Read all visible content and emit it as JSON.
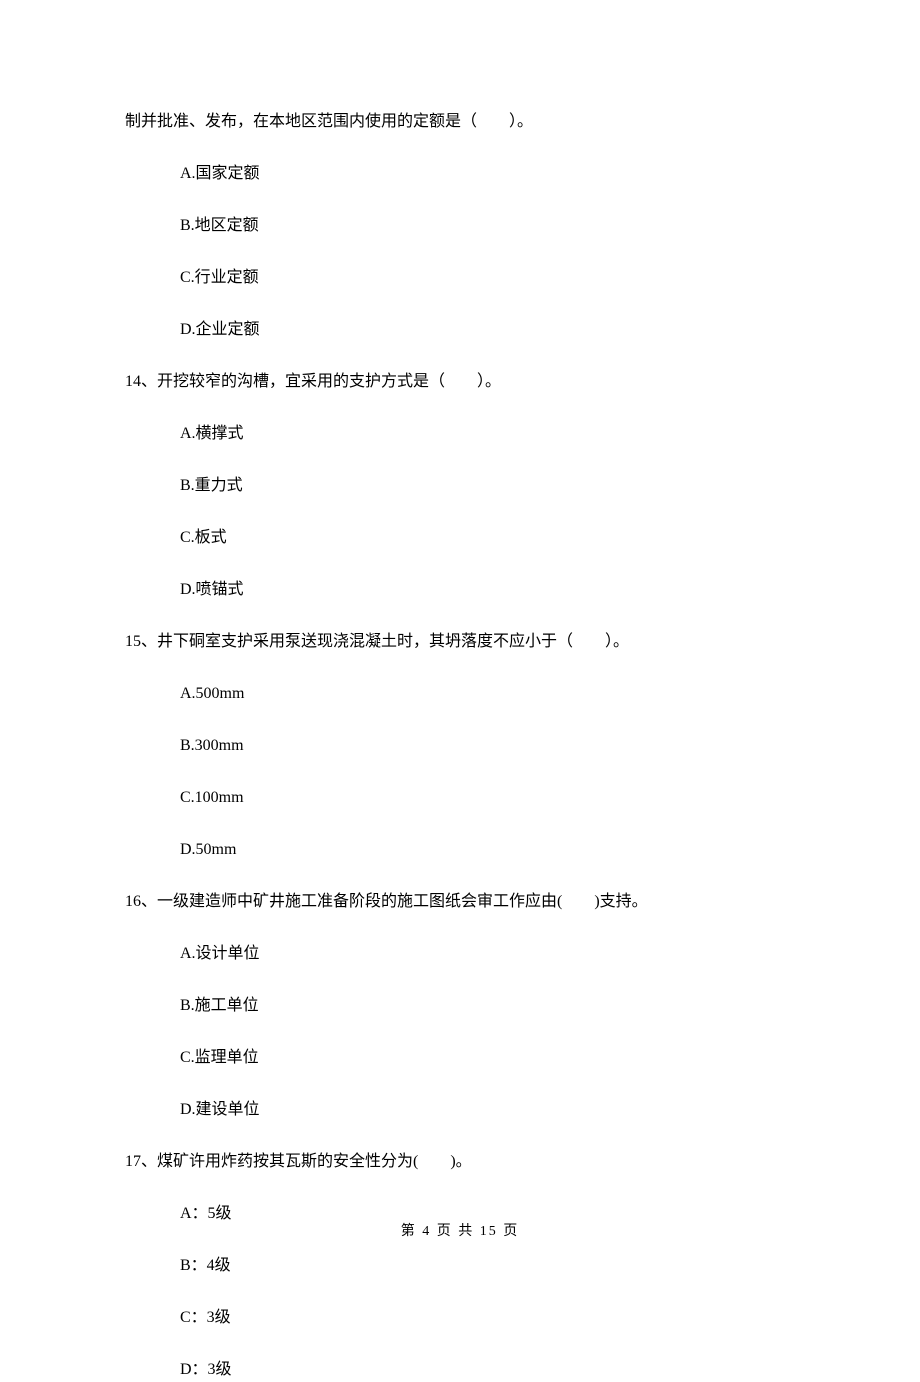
{
  "partial_question": {
    "text": "制并批准、发布，在本地区范围内使用的定额是（　　）。",
    "options": {
      "a": "A.国家定额",
      "b": "B.地区定额",
      "c": "C.行业定额",
      "d": "D.企业定额"
    }
  },
  "q14": {
    "text": "14、开挖较窄的沟槽，宜采用的支护方式是（　　）。",
    "options": {
      "a": "A.横撑式",
      "b": "B.重力式",
      "c": "C.板式",
      "d": "D.喷锚式"
    }
  },
  "q15": {
    "text": "15、井下硐室支护采用泵送现浇混凝土时，其坍落度不应小于（　　）。",
    "options": {
      "a": "A.500mm",
      "b": "B.300mm",
      "c": "C.100mm",
      "d": "D.50mm"
    }
  },
  "q16": {
    "text": "16、一级建造师中矿井施工准备阶段的施工图纸会审工作应由(　　)支持。",
    "options": {
      "a": "A.设计单位",
      "b": "B.施工单位",
      "c": "C.监理单位",
      "d": "D.建设单位"
    }
  },
  "q17": {
    "text": "17、煤矿许用炸药按其瓦斯的安全性分为(　　)。",
    "options": {
      "a": "A：5级",
      "b": "B：4级",
      "c": "C：3级",
      "d": "D：3级"
    }
  },
  "footer": "第 4 页 共 15 页"
}
